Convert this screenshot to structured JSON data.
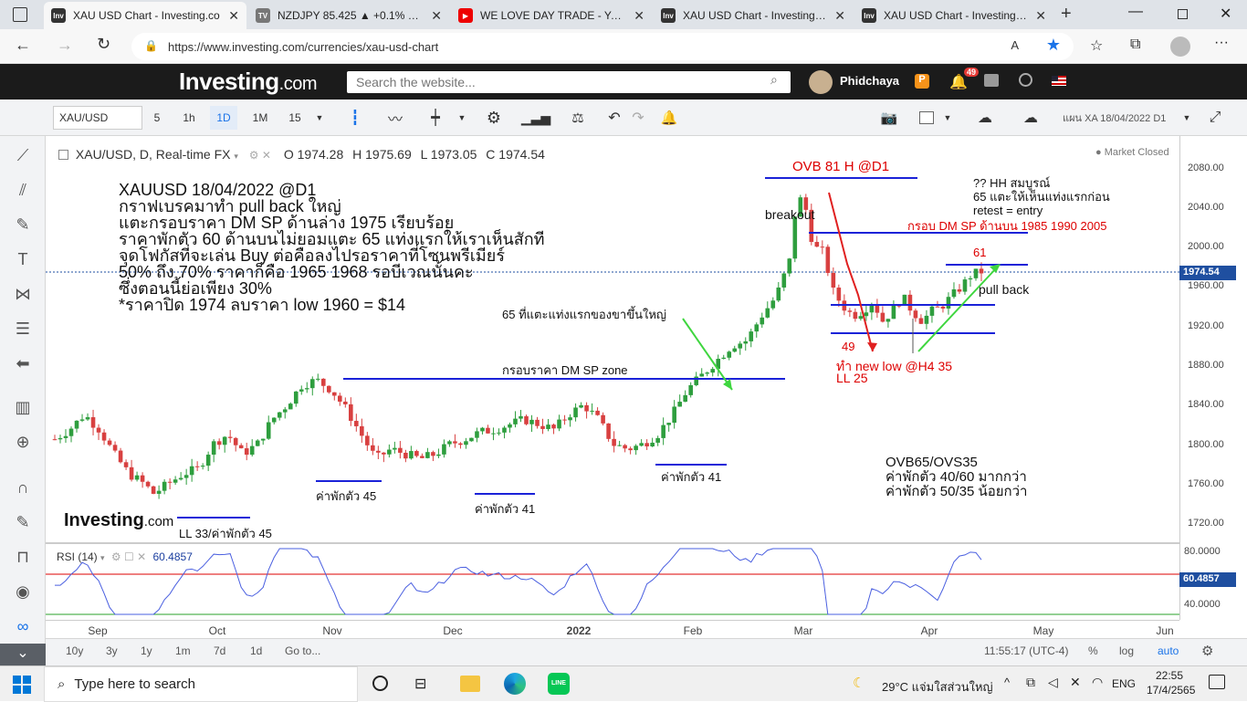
{
  "tabs": [
    {
      "label": "XAU USD Chart - Investing.co",
      "fav": "Inv",
      "favcolor": "#333"
    },
    {
      "label": "NZDJPY 85.425 ▲ +0.1% XAU",
      "fav": "TV",
      "favcolor": "#777"
    },
    {
      "label": "WE LOVE DAY TRADE - YouTu",
      "fav": "▶",
      "favcolor": "#e00"
    },
    {
      "label": "XAU USD Chart - Investing.co",
      "fav": "Inv",
      "favcolor": "#333"
    },
    {
      "label": "XAU USD Chart - Investing.co",
      "fav": "Inv",
      "favcolor": "#333"
    }
  ],
  "url": "https://www.investing.com/currencies/xau-usd-chart",
  "site": {
    "logo": "Investing",
    "logo_suffix": ".com",
    "search_placeholder": "Search the website...",
    "user": "Phidchaya",
    "notif_count": "49"
  },
  "toolbar": {
    "symbol": "XAU/USD",
    "intervals": [
      "5",
      "1h",
      "1D",
      "1M",
      "15"
    ],
    "layout_name": "แผน XA 18/04/2022 D1"
  },
  "chart": {
    "title": "XAU/USD, D, Real-time FX",
    "open": "O 1974.28",
    "high": "H 1975.69",
    "low": "L 1973.05",
    "close": "C 1974.54",
    "status": "Market Closed",
    "price_ticks": [
      "2080.00",
      "2040.00",
      "2000.00",
      "1960.00",
      "1920.00",
      "1880.00",
      "1840.00",
      "1800.00",
      "1760.00",
      "1720.00"
    ],
    "last_price": "1974.54",
    "rsi_label": "RSI (14)",
    "rsi_value": "60.4857",
    "rsi_ticks": [
      "80.0000",
      "60.4857",
      "40.0000"
    ],
    "months": [
      "Sep",
      "Oct",
      "Nov",
      "Dec",
      "2022",
      "Feb",
      "Mar",
      "Apr",
      "May",
      "Jun"
    ],
    "watermark": "Investing",
    "watermark_suffix": ".com"
  },
  "annotations": {
    "main_lines": [
      "XAUUSD 18/04/2022 @D1",
      "กราฟเบรคมาทำ pull back ใหญ่",
      "แตะกรอบราคา DM SP ด้านล่าง 1975 เรียบร้อย",
      "ราคาพักตัว 60 ด้านบนไม่ยอมแตะ 65 แท่งแรกให้เราเห็นสักที",
      "จุดโฟกัสที่จะเล่น Buy ต่อคือลงไปรอราคาที่โซนพรีเมียร์",
      "50% ถึง 70% ราคาก็คือ 1965 1968 รอบีเวณนั้นคะ",
      "ซึ่งตอนนี้ย่อเพียง 30%",
      "*ราคาปิด 1974 ลบราคา low 1960 = $14"
    ],
    "ovb": "OVB 81 H @D1",
    "breakout": "breakout",
    "hh_lines": [
      "?? HH สมบูรณ์",
      "65 แตะให้เห็นแท่งแรกก่อน",
      "retest = entry"
    ],
    "dm_top": "กรอบ DM SP ด้านบน 1985 1990 2005",
    "n61": "61",
    "pullback": "pull back",
    "n65": "65 ที่แตะแท่งแรกของขาขึ้นใหญ่",
    "n49": "49",
    "newlow1": "ทำ new low @H4 35",
    "newlow2": "LL 25",
    "dmzone": "กรอบราคา DM SP zone",
    "ovb65": [
      "OVB65/OVS35",
      "ค่าพักตัว 40/60 มากกว่า",
      "ค่าพักตัว 50/35 น้อยกว่า"
    ],
    "r45": "ค่าพักตัว 45",
    "r41a": "ค่าพักตัว 41",
    "r41b": "ค่าพักตัว 41",
    "ll33": "LL 33/ค่าพักตัว 45"
  },
  "bottom": {
    "ranges": [
      "10y",
      "3y",
      "1y",
      "1m",
      "7d",
      "1d",
      "Go to..."
    ],
    "time": "11:55:17 (UTC-4)",
    "pct": "%",
    "log": "log",
    "auto": "auto"
  },
  "taskbar": {
    "search": "Type here to search",
    "weather": "29°C  แจ่มใสส่วนใหญ่",
    "lang": "ENG",
    "time": "22:55",
    "date": "17/4/2565"
  }
}
